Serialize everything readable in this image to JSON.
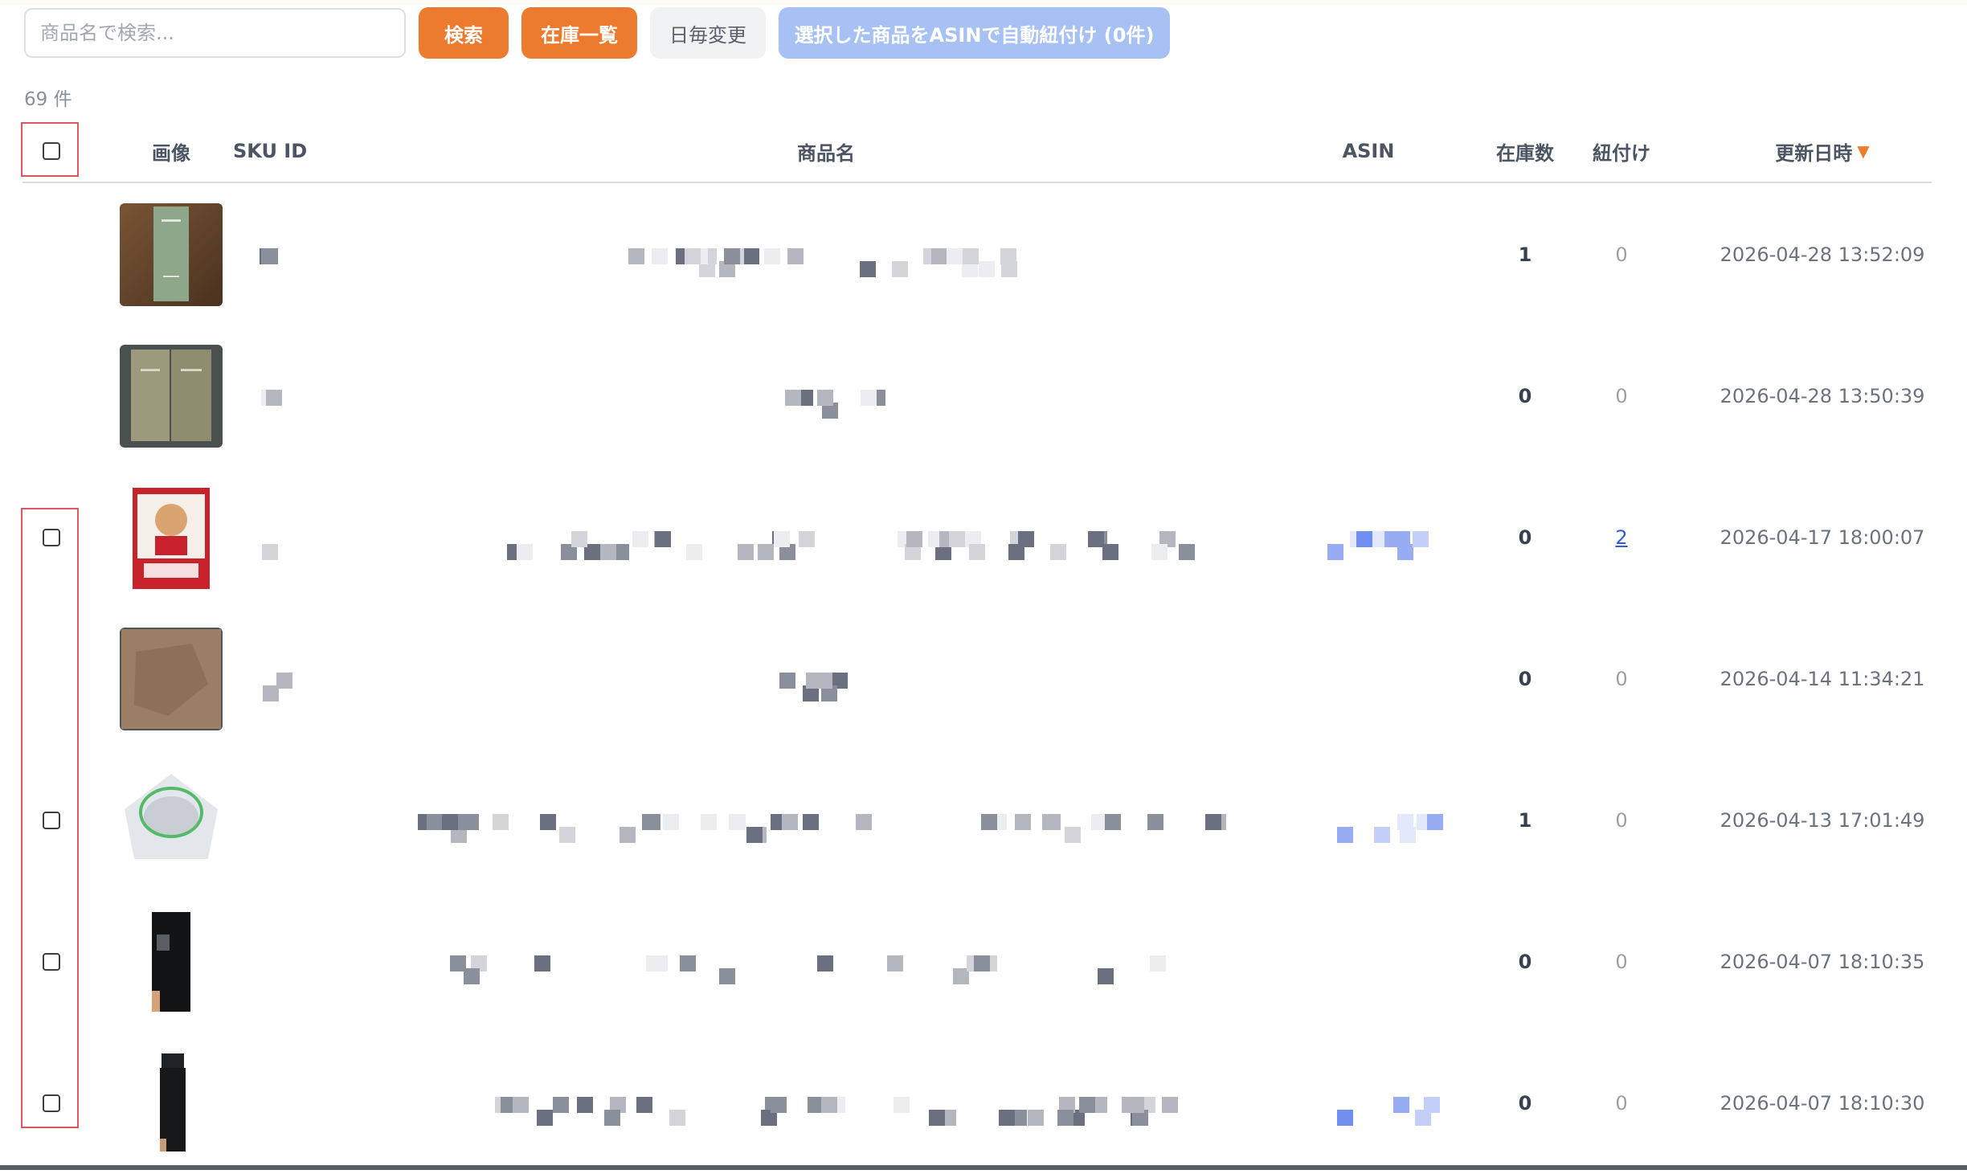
{
  "toolbar": {
    "search_placeholder": "商品名で検索...",
    "search_label": "検索",
    "stock_list_label": "在庫一覧",
    "daily_change_label": "日毎変更",
    "auto_link_label": "選択した商品をASINで自動紐付け (0件)"
  },
  "count_label": "69 件",
  "columns": {
    "image": "画像",
    "sku": "SKU ID",
    "name": "商品名",
    "asin": "ASIN",
    "stock": "在庫数",
    "linked": "紐付け",
    "updated": "更新日時"
  },
  "sort_indicator": "▼",
  "rows": [
    {
      "stock": "1",
      "linked": "0",
      "updated": "2026-04-28 13:52:09",
      "checkbox": false,
      "thumb": "green-bottle-on-wood"
    },
    {
      "stock": "0",
      "linked": "0",
      "updated": "2026-04-28 13:50:39",
      "checkbox": false,
      "thumb": "two-olive-bottles"
    },
    {
      "stock": "0",
      "linked": "2",
      "updated": "2026-04-17 18:00:07",
      "checkbox": true,
      "thumb": "one-piece-card"
    },
    {
      "stock": "0",
      "linked": "0",
      "updated": "2026-04-14 11:34:21",
      "checkbox": false,
      "thumb": "brown-bag"
    },
    {
      "stock": "1",
      "linked": "0",
      "updated": "2026-04-13 17:01:49",
      "checkbox": true,
      "thumb": "clear-case"
    },
    {
      "stock": "0",
      "linked": "0",
      "updated": "2026-04-07 18:10:35",
      "checkbox": true,
      "thumb": "black-tube-box"
    },
    {
      "stock": "0",
      "linked": "0",
      "updated": "2026-04-07 18:10:30",
      "checkbox": true,
      "thumb": "black-tube"
    }
  ],
  "colors": {
    "accent_orange": "#ec7a2f",
    "disabled_blue": "#a7c1f5",
    "link_blue": "#2f5fd0",
    "highlight_red": "#e0555f"
  }
}
